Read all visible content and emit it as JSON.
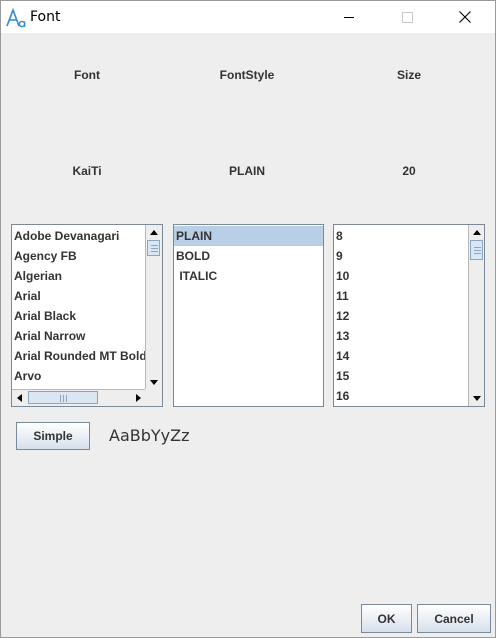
{
  "window": {
    "title": "Font",
    "icon": "font-app-icon",
    "controls": [
      "minimize-icon",
      "maximize-icon",
      "close-icon"
    ]
  },
  "labels": {
    "font": "Font",
    "font_style": "FontStyle",
    "size": "Size"
  },
  "current": {
    "font": "KaiTi",
    "style": "PLAIN",
    "size": "20"
  },
  "font_list": {
    "items": [
      "Adobe Devanagari",
      "Agency FB",
      "Algerian",
      "Arial",
      "Arial Black",
      "Arial Narrow",
      "Arial Rounded MT Bold",
      "Arvo"
    ]
  },
  "style_list": {
    "items": [
      "PLAIN",
      "BOLD",
      " ITALIC"
    ],
    "selected": "PLAIN"
  },
  "size_list": {
    "items": [
      "8",
      "9",
      "10",
      "11",
      "12",
      "13",
      "14",
      "15",
      "16"
    ]
  },
  "simple_button": "Simple",
  "preview_text": "AaBbYyZz",
  "footer": {
    "ok": "OK",
    "cancel": "Cancel"
  },
  "colors": {
    "selection": "#b8cfe5",
    "background": "#eeeeee",
    "icon_accent": "#2e8bd0"
  }
}
